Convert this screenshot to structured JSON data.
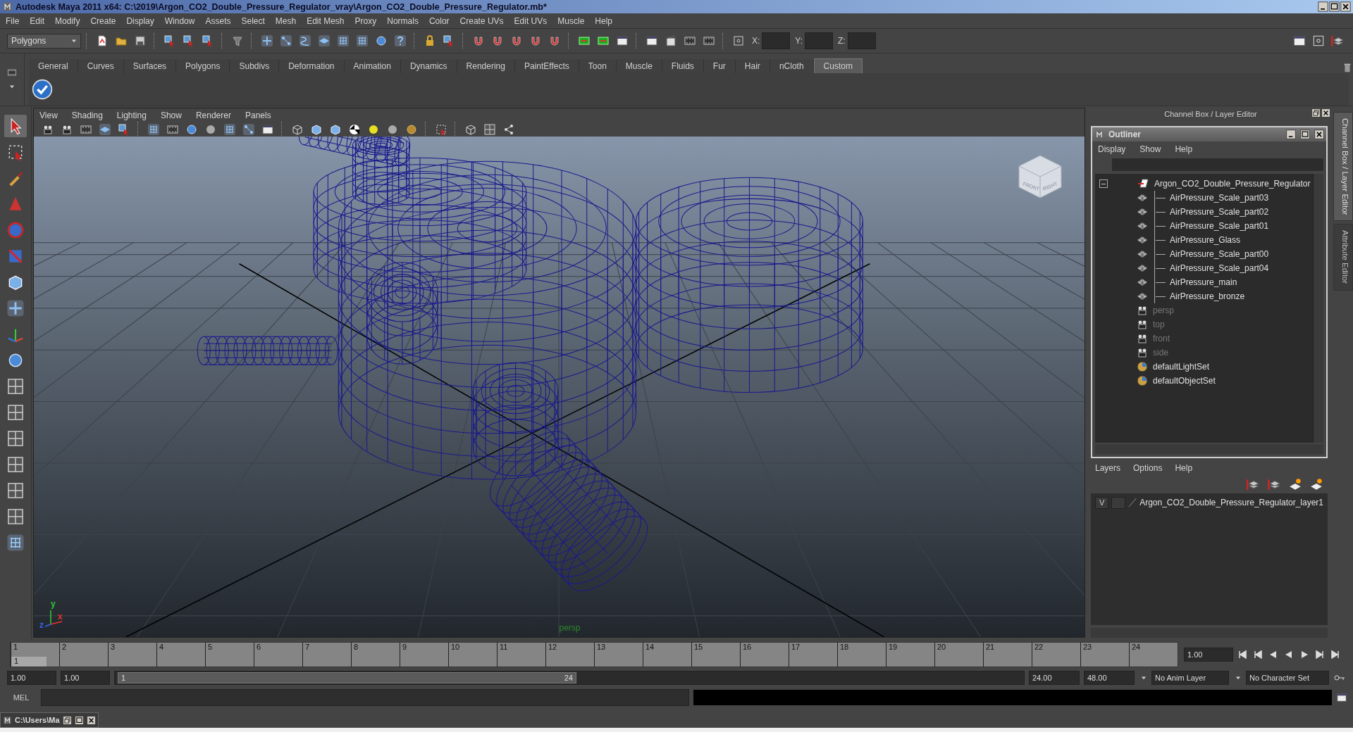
{
  "window": {
    "title": "Autodesk Maya 2011 x64: C:\\2019\\Argon_CO2_Double_Pressure_Regulator_vray\\Argon_CO2_Double_Pressure_Regulator.mb*"
  },
  "menu": [
    "File",
    "Edit",
    "Modify",
    "Create",
    "Display",
    "Window",
    "Assets",
    "Select",
    "Mesh",
    "Edit Mesh",
    "Proxy",
    "Normals",
    "Color",
    "Create UVs",
    "Edit UVs",
    "Muscle",
    "Help"
  ],
  "toolbar": {
    "mode": "Polygons",
    "coords": [
      "X:",
      "Y:",
      "Z:"
    ]
  },
  "shelf_tabs": [
    {
      "label": "General",
      "selected": false
    },
    {
      "label": "Curves",
      "selected": false
    },
    {
      "label": "Surfaces",
      "selected": false
    },
    {
      "label": "Polygons",
      "selected": false
    },
    {
      "label": "Subdivs",
      "selected": false
    },
    {
      "label": "Deformation",
      "selected": false
    },
    {
      "label": "Animation",
      "selected": false
    },
    {
      "label": "Dynamics",
      "selected": false
    },
    {
      "label": "Rendering",
      "selected": false
    },
    {
      "label": "PaintEffects",
      "selected": false
    },
    {
      "label": "Toon",
      "selected": false
    },
    {
      "label": "Muscle",
      "selected": false
    },
    {
      "label": "Fluids",
      "selected": false
    },
    {
      "label": "Fur",
      "selected": false
    },
    {
      "label": "Hair",
      "selected": false
    },
    {
      "label": "nCloth",
      "selected": false
    },
    {
      "label": "Custom",
      "selected": true
    }
  ],
  "viewport": {
    "menu": [
      "View",
      "Shading",
      "Lighting",
      "Show",
      "Renderer",
      "Panels"
    ],
    "camera_label": "persp",
    "view_cube": [
      "FRONT",
      "RIGHT"
    ],
    "axes": [
      "y",
      "x",
      "z"
    ]
  },
  "channel_box": {
    "title": "Channel Box / Layer Editor"
  },
  "outliner": {
    "title": "Outliner",
    "menu": [
      "Display",
      "Show",
      "Help"
    ],
    "items": [
      {
        "label": "Argon_CO2_Double_Pressure_Regulator",
        "kind": "group",
        "dimmed": false,
        "expanded": true,
        "children": [
          {
            "label": "AirPressure_Scale_part03",
            "kind": "mesh",
            "dimmed": false
          },
          {
            "label": "AirPressure_Scale_part02",
            "kind": "mesh",
            "dimmed": false
          },
          {
            "label": "AirPressure_Scale_part01",
            "kind": "mesh",
            "dimmed": false
          },
          {
            "label": "AirPressure_Glass",
            "kind": "mesh",
            "dimmed": false
          },
          {
            "label": "AirPressure_Scale_part00",
            "kind": "mesh",
            "dimmed": false
          },
          {
            "label": "AirPressure_Scale_part04",
            "kind": "mesh",
            "dimmed": false
          },
          {
            "label": "AirPressure_main",
            "kind": "mesh",
            "dimmed": false
          },
          {
            "label": "AirPressure_bronze",
            "kind": "mesh",
            "dimmed": false
          }
        ]
      },
      {
        "label": "persp",
        "kind": "camera",
        "dimmed": true
      },
      {
        "label": "top",
        "kind": "camera",
        "dimmed": true
      },
      {
        "label": "front",
        "kind": "camera",
        "dimmed": true
      },
      {
        "label": "side",
        "kind": "camera",
        "dimmed": true
      },
      {
        "label": "defaultLightSet",
        "kind": "set",
        "dimmed": false
      },
      {
        "label": "defaultObjectSet",
        "kind": "set",
        "dimmed": false
      }
    ]
  },
  "layers": {
    "menu": [
      "Layers",
      "Options",
      "Help"
    ],
    "rows": [
      {
        "visibility": "V",
        "name": "Argon_CO2_Double_Pressure_Regulator_layer1"
      }
    ]
  },
  "side_tabs": [
    {
      "label": "Channel Box / Layer Editor",
      "selected": true
    },
    {
      "label": "Attribute Editor",
      "selected": false
    }
  ],
  "timeline": {
    "frames": [
      "1",
      "2",
      "3",
      "4",
      "5",
      "6",
      "7",
      "8",
      "9",
      "10",
      "11",
      "12",
      "13",
      "14",
      "15",
      "16",
      "17",
      "18",
      "19",
      "20",
      "21",
      "22",
      "23",
      "24"
    ],
    "current": "1",
    "current_field": "1.00"
  },
  "range": {
    "start": "1.00",
    "playback_start": "1.00",
    "slider_start": "1",
    "slider_end": "24",
    "level": 0.5,
    "playback_end": "24.00",
    "end": "48.00",
    "anim_layer": "No Anim Layer",
    "character_set": "No Character Set"
  },
  "command_line": {
    "label": "MEL"
  },
  "taskbar": [
    {
      "label": "C:\\Users\\Ma"
    }
  ]
}
